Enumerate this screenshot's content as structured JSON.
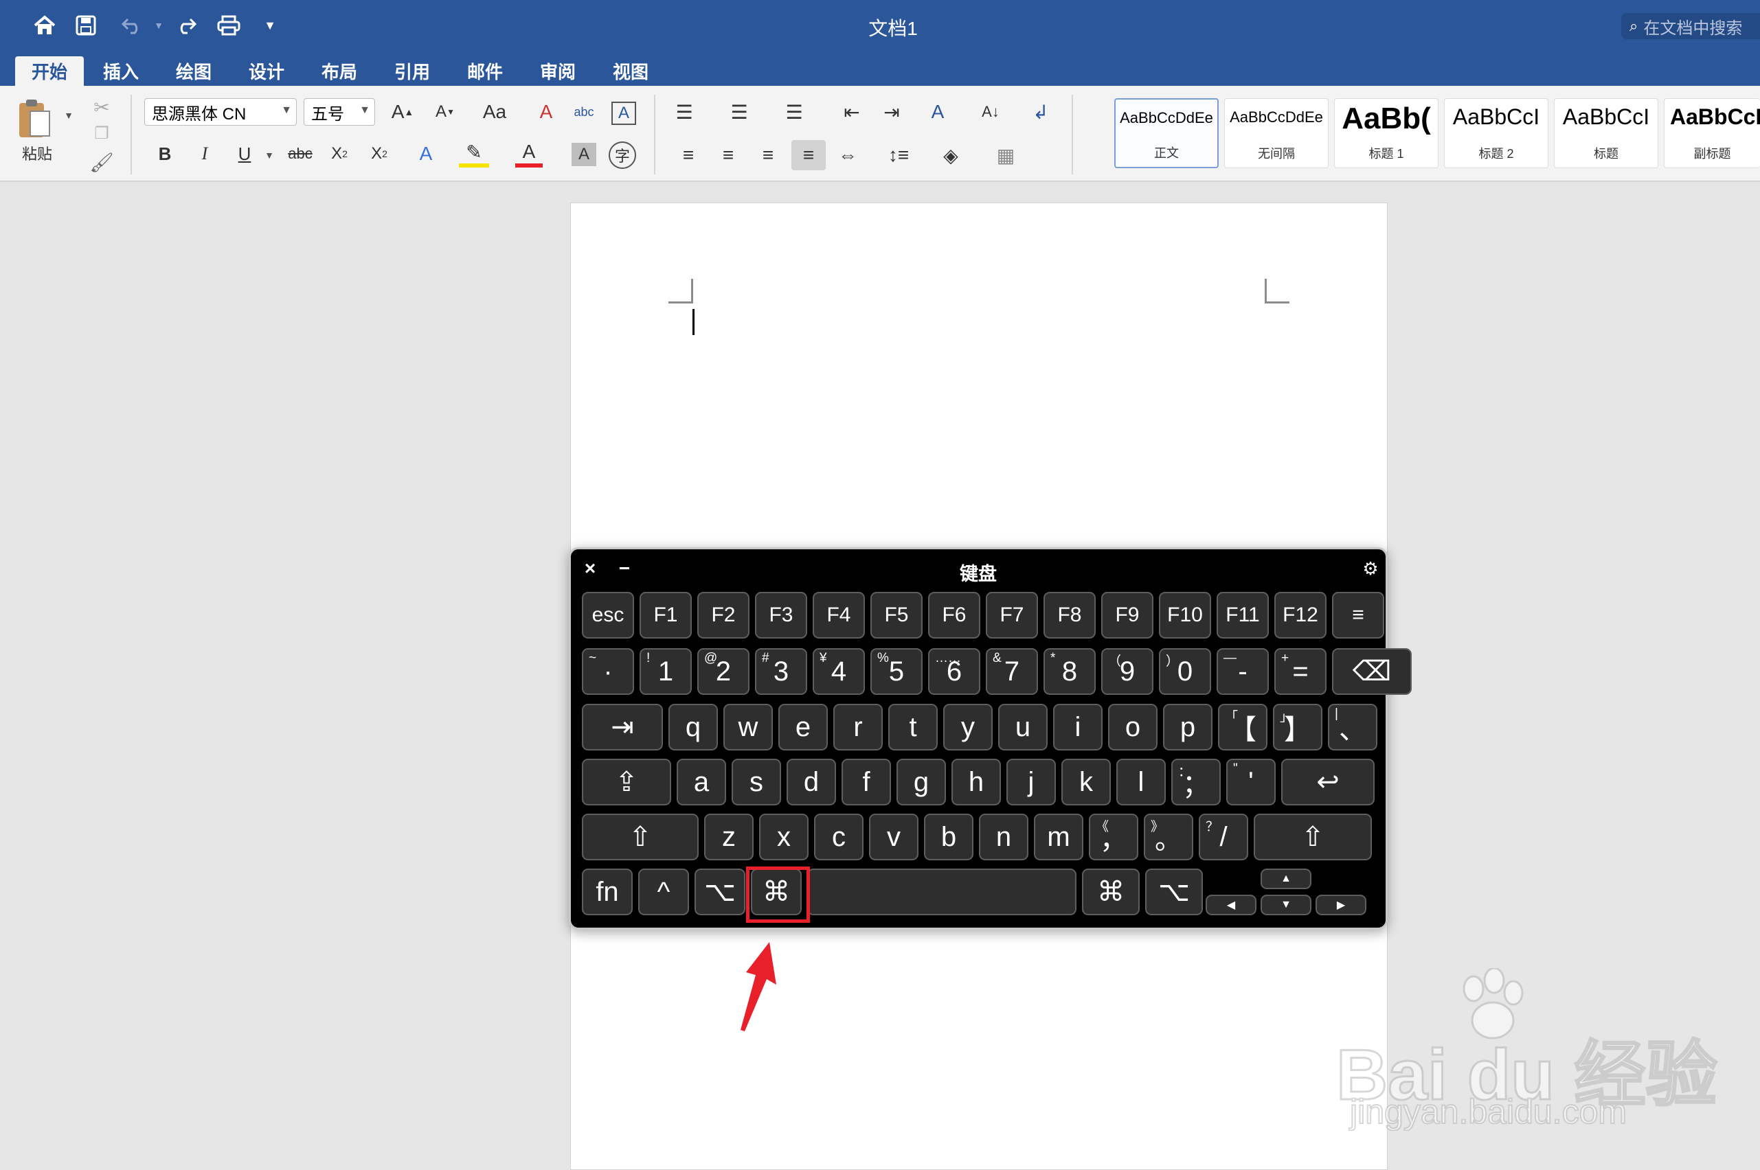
{
  "window": {
    "title": "文档1",
    "search_placeholder": "在文档中搜索"
  },
  "tabs": [
    "开始",
    "插入",
    "绘图",
    "设计",
    "布局",
    "引用",
    "邮件",
    "审阅",
    "视图"
  ],
  "ribbon": {
    "paste_label": "粘贴",
    "font_name": "思源黑体 CN",
    "font_size": "五号",
    "styles": [
      {
        "preview": "AaBbCcDdEe",
        "name": "正文"
      },
      {
        "preview": "AaBbCcDdEe",
        "name": "无间隔"
      },
      {
        "preview": "AaBb(",
        "name": "标题 1"
      },
      {
        "preview": "AaBbCcI",
        "name": "标题 2"
      },
      {
        "preview": "AaBbCcI",
        "name": "标题"
      },
      {
        "preview": "AaBbCcI",
        "name": "副标题"
      }
    ]
  },
  "keyboard": {
    "title": "键盘",
    "close": "×",
    "minimize": "−",
    "settings": "⚙",
    "row_fn": [
      "esc",
      "F1",
      "F2",
      "F3",
      "F4",
      "F5",
      "F6",
      "F7",
      "F8",
      "F9",
      "F10",
      "F11",
      "F12",
      "≡"
    ],
    "row_num": [
      {
        "main": "·",
        "sub": "~"
      },
      {
        "main": "1",
        "sub": "!"
      },
      {
        "main": "2",
        "sub": "@"
      },
      {
        "main": "3",
        "sub": "#"
      },
      {
        "main": "4",
        "sub": "¥"
      },
      {
        "main": "5",
        "sub": "%"
      },
      {
        "main": "6",
        "sub": "……"
      },
      {
        "main": "7",
        "sub": "&"
      },
      {
        "main": "8",
        "sub": "*"
      },
      {
        "main": "9",
        "sub": "（"
      },
      {
        "main": "0",
        "sub": "）"
      },
      {
        "main": "-",
        "sub": "—"
      },
      {
        "main": "=",
        "sub": "+"
      },
      {
        "main": "⌫",
        "sub": ""
      }
    ],
    "row_q": [
      {
        "main": "⇥",
        "sub": ""
      },
      {
        "main": "q",
        "sub": ""
      },
      {
        "main": "w",
        "sub": ""
      },
      {
        "main": "e",
        "sub": ""
      },
      {
        "main": "r",
        "sub": ""
      },
      {
        "main": "t",
        "sub": ""
      },
      {
        "main": "y",
        "sub": ""
      },
      {
        "main": "u",
        "sub": ""
      },
      {
        "main": "i",
        "sub": ""
      },
      {
        "main": "o",
        "sub": ""
      },
      {
        "main": "p",
        "sub": ""
      },
      {
        "main": "【",
        "sub": "「"
      },
      {
        "main": "】",
        "sub": "」"
      },
      {
        "main": "、",
        "sub": "|"
      }
    ],
    "row_a": [
      {
        "main": "⇪",
        "sub": ""
      },
      {
        "main": "a",
        "sub": ""
      },
      {
        "main": "s",
        "sub": ""
      },
      {
        "main": "d",
        "sub": ""
      },
      {
        "main": "f",
        "sub": ""
      },
      {
        "main": "g",
        "sub": ""
      },
      {
        "main": "h",
        "sub": ""
      },
      {
        "main": "j",
        "sub": ""
      },
      {
        "main": "k",
        "sub": ""
      },
      {
        "main": "l",
        "sub": ""
      },
      {
        "main": "；",
        "sub": "："
      },
      {
        "main": "'",
        "sub": "\""
      },
      {
        "main": "↩",
        "sub": ""
      }
    ],
    "row_z": [
      {
        "main": "⇧",
        "sub": ""
      },
      {
        "main": "z",
        "sub": ""
      },
      {
        "main": "x",
        "sub": ""
      },
      {
        "main": "c",
        "sub": ""
      },
      {
        "main": "v",
        "sub": ""
      },
      {
        "main": "b",
        "sub": ""
      },
      {
        "main": "n",
        "sub": ""
      },
      {
        "main": "m",
        "sub": ""
      },
      {
        "main": "，",
        "sub": "《"
      },
      {
        "main": "。",
        "sub": "》"
      },
      {
        "main": "/",
        "sub": "？"
      },
      {
        "main": "⇧",
        "sub": ""
      }
    ],
    "row_bottom": [
      "fn",
      "^",
      "⌥",
      "⌘",
      "",
      "⌘",
      "⌥"
    ],
    "arrows": {
      "up": "▲",
      "left": "◀",
      "down": "▼",
      "right": "▶"
    }
  },
  "watermark": {
    "logo": "Bai du 经验",
    "url": "jingyan.baidu.com"
  },
  "colors": {
    "titlebar": "#2b579a",
    "highlight": "#e8202a",
    "keyboard_bg": "#000000",
    "key_bg": "#2e2e2e"
  }
}
